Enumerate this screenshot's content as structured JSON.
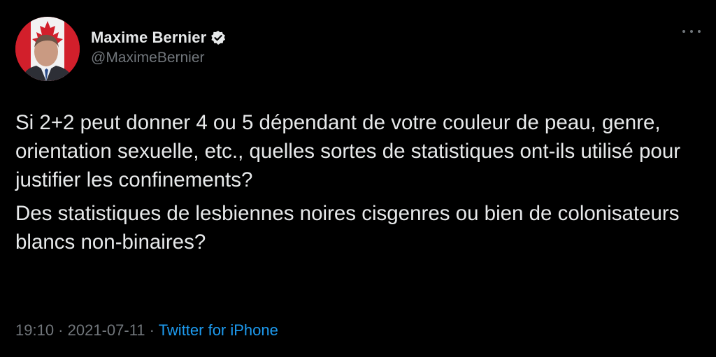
{
  "author": {
    "display_name": "Maxime Bernier",
    "handle": "@MaximeBernier",
    "verified": true,
    "verified_color": "#e7e9ea"
  },
  "tweet": {
    "paragraphs": [
      "Si 2+2 peut donner 4 ou 5 dépendant de votre couleur de peau, genre, orientation sexuelle, etc., quelles sortes de statistiques ont-ils utilisé pour justifier les confinements?",
      "Des statistiques de lesbiennes noires cisgenres ou bien de colonisateurs blancs non-binaires?"
    ]
  },
  "meta": {
    "time": "19:10",
    "separator1": " · ",
    "date": "2021-07-11",
    "separator2": " · ",
    "source": "Twitter for iPhone"
  },
  "icons": {
    "more": "more-horizontal-icon",
    "verified": "verified-badge-icon"
  },
  "colors": {
    "background": "#000000",
    "text": "#e7e9ea",
    "secondary": "#71767b",
    "link": "#1d9bf0"
  }
}
